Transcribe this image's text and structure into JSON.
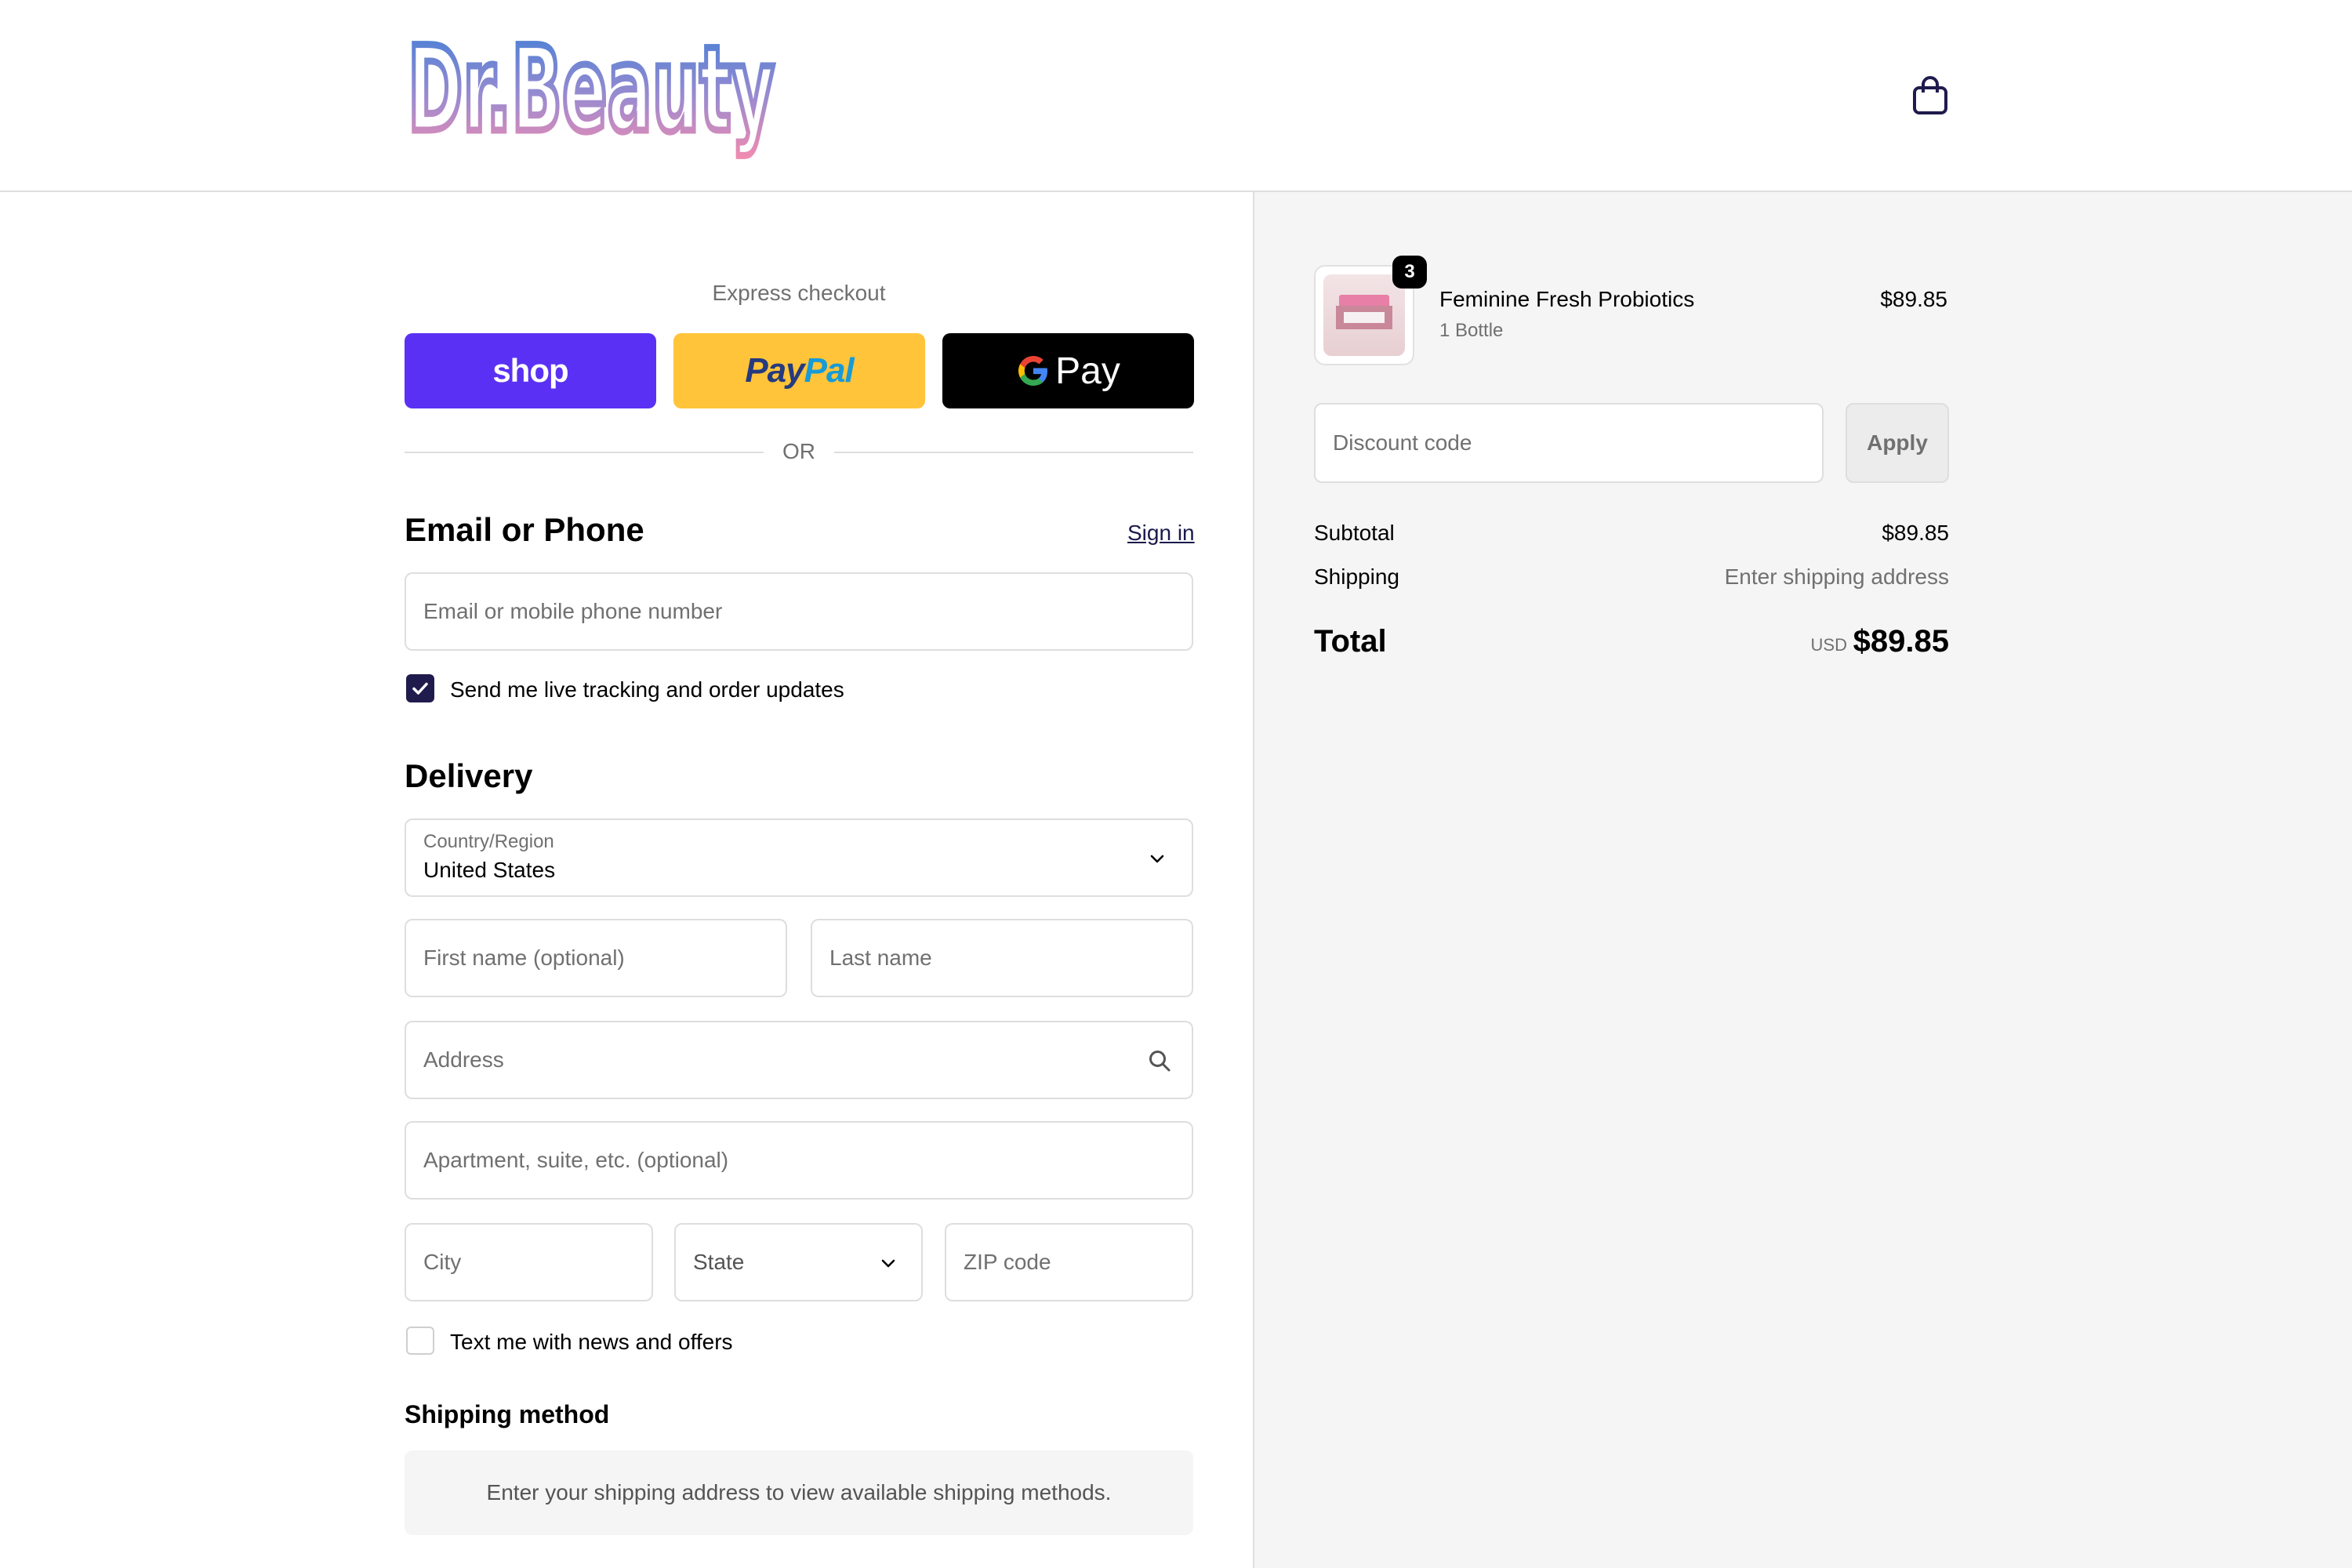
{
  "header": {
    "logo_text": "Dr.Beauty",
    "cart_icon": "shopping-bag-icon"
  },
  "express": {
    "label": "Express checkout",
    "buttons": [
      {
        "name": "shop",
        "label": "shop",
        "color": "#5a31f4"
      },
      {
        "name": "paypal",
        "label_part1": "Pay",
        "label_part2": "Pal",
        "color": "#ffc439"
      },
      {
        "name": "gpay",
        "label": "Pay",
        "color": "#000000"
      }
    ],
    "or_text": "OR"
  },
  "contact": {
    "title": "Email or Phone",
    "sign_in": "Sign in",
    "email_placeholder": "Email or mobile phone number",
    "tracking_checkbox_label": "Send me live tracking and order updates",
    "tracking_checked": true
  },
  "delivery": {
    "title": "Delivery",
    "country_label": "Country/Region",
    "country_value": "United States",
    "first_name_placeholder": "First name (optional)",
    "last_name_placeholder": "Last name",
    "address_placeholder": "Address",
    "apartment_placeholder": "Apartment, suite, etc. (optional)",
    "city_placeholder": "City",
    "state_placeholder": "State",
    "zip_placeholder": "ZIP code",
    "sms_checkbox_label": "Text me with news and offers",
    "sms_checked": false
  },
  "shipping_method": {
    "title": "Shipping method",
    "notice": "Enter your shipping address to view available shipping methods."
  },
  "summary": {
    "product": {
      "name": "Feminine Fresh Probiotics",
      "variant": "1 Bottle",
      "price": "$89.85",
      "quantity": "3"
    },
    "discount_placeholder": "Discount code",
    "apply_label": "Apply",
    "subtotal_label": "Subtotal",
    "subtotal_value": "$89.85",
    "shipping_label": "Shipping",
    "shipping_value": "Enter shipping address",
    "total_label": "Total",
    "total_currency": "USD",
    "total_value": "$89.85"
  },
  "colors": {
    "accent": "#1f1b4d",
    "border": "#dedede",
    "muted_text": "#707070",
    "panel_bg": "#f5f5f5"
  }
}
